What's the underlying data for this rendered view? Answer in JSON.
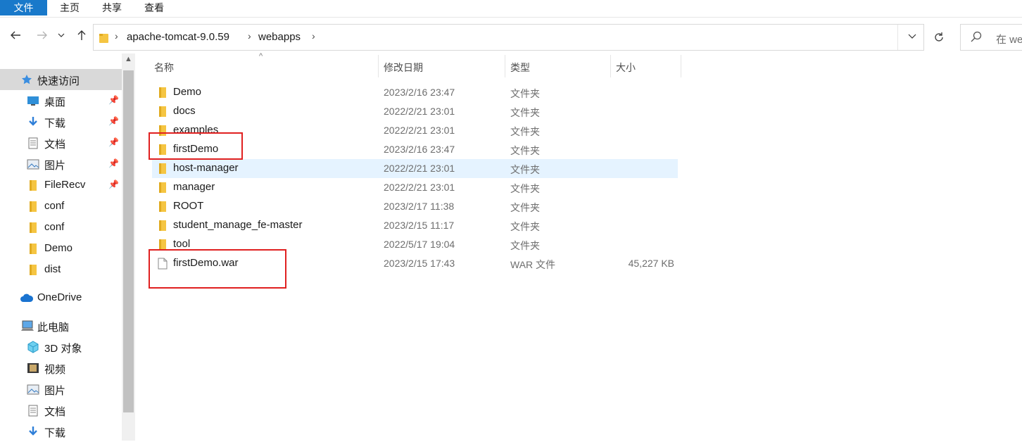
{
  "ribbon": {
    "tabs": [
      "文件",
      "主页",
      "共享",
      "查看"
    ]
  },
  "nav": {
    "back_icon": "back-arrow-icon",
    "forward_icon": "forward-arrow-icon",
    "recent_icon": "chevron-down-icon",
    "up_icon": "up-arrow-icon"
  },
  "address": {
    "breadcrumbs": [
      "apache-tomcat-9.0.59",
      "webapps"
    ],
    "separator": "›"
  },
  "search": {
    "placeholder": "在 we"
  },
  "sidebar": {
    "items": [
      {
        "label": "快速访问",
        "icon": "star-icon",
        "pinned": false,
        "selected": true
      },
      {
        "label": "桌面",
        "icon": "desktop-icon",
        "pinned": true
      },
      {
        "label": "下载",
        "icon": "download-icon",
        "pinned": true
      },
      {
        "label": "文档",
        "icon": "document-icon",
        "pinned": true
      },
      {
        "label": "图片",
        "icon": "picture-icon",
        "pinned": true
      },
      {
        "label": "FileRecv",
        "icon": "folder-icon",
        "pinned": true
      },
      {
        "label": "conf",
        "icon": "folder-icon",
        "pinned": false
      },
      {
        "label": "conf",
        "icon": "folder-icon",
        "pinned": false
      },
      {
        "label": "Demo",
        "icon": "folder-icon",
        "pinned": false
      },
      {
        "label": "dist",
        "icon": "folder-icon",
        "pinned": false
      },
      {
        "label": "OneDrive",
        "icon": "cloud-icon",
        "pinned": false
      },
      {
        "label": "此电脑",
        "icon": "computer-icon",
        "pinned": false
      },
      {
        "label": "3D 对象",
        "icon": "3d-objects-icon",
        "pinned": false
      },
      {
        "label": "视频",
        "icon": "video-icon",
        "pinned": false
      },
      {
        "label": "图片",
        "icon": "picture-icon",
        "pinned": false
      },
      {
        "label": "文档",
        "icon": "document-icon",
        "pinned": false
      },
      {
        "label": "下载",
        "icon": "download-icon",
        "pinned": false
      }
    ]
  },
  "columns": {
    "name": "名称",
    "modified": "修改日期",
    "type": "类型",
    "size": "大小"
  },
  "files": [
    {
      "name": "Demo",
      "modified": "2023/2/16 23:47",
      "type": "文件夹",
      "size": "",
      "kind": "folder"
    },
    {
      "name": "docs",
      "modified": "2022/2/21 23:01",
      "type": "文件夹",
      "size": "",
      "kind": "folder"
    },
    {
      "name": "examples",
      "modified": "2022/2/21 23:01",
      "type": "文件夹",
      "size": "",
      "kind": "folder"
    },
    {
      "name": "firstDemo",
      "modified": "2023/2/16 23:47",
      "type": "文件夹",
      "size": "",
      "kind": "folder"
    },
    {
      "name": "host-manager",
      "modified": "2022/2/21 23:01",
      "type": "文件夹",
      "size": "",
      "kind": "folder",
      "hovered": true
    },
    {
      "name": "manager",
      "modified": "2022/2/21 23:01",
      "type": "文件夹",
      "size": "",
      "kind": "folder"
    },
    {
      "name": "ROOT",
      "modified": "2023/2/17 11:38",
      "type": "文件夹",
      "size": "",
      "kind": "folder"
    },
    {
      "name": "student_manage_fe-master",
      "modified": "2023/2/15 11:17",
      "type": "文件夹",
      "size": "",
      "kind": "folder"
    },
    {
      "name": "tool",
      "modified": "2022/5/17 19:04",
      "type": "文件夹",
      "size": "",
      "kind": "folder"
    },
    {
      "name": "firstDemo.war",
      "modified": "2023/2/15 17:43",
      "type": "WAR 文件",
      "size": "45,227 KB",
      "kind": "file"
    }
  ],
  "colors": {
    "accent": "#1979ca",
    "hover": "#e5f3ff",
    "selected": "#d9d9d9",
    "annotation": "#e02020",
    "folder": "#f5c542"
  }
}
